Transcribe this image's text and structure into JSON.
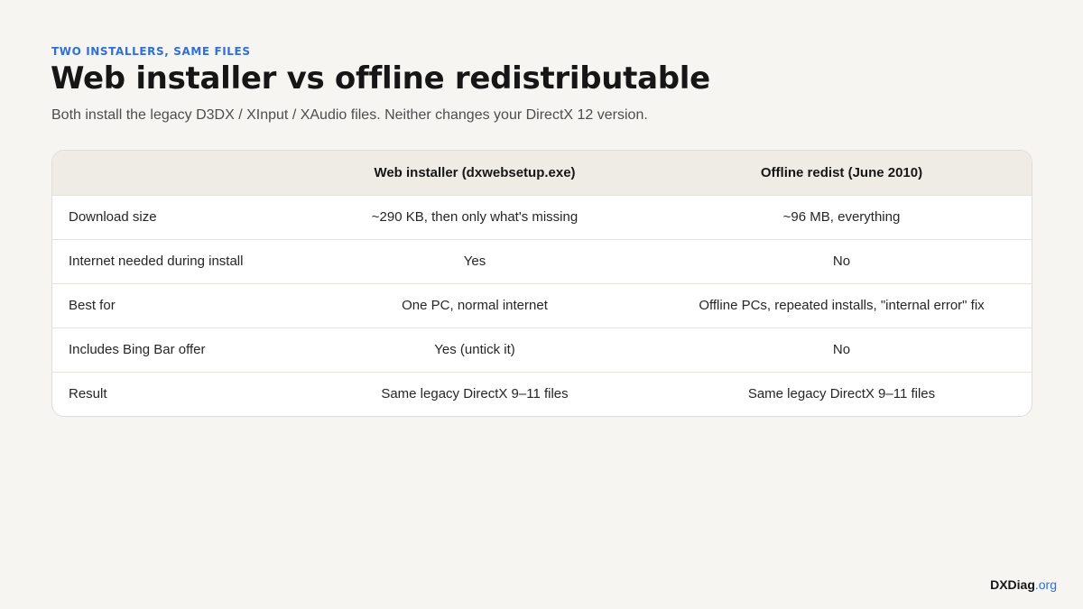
{
  "header": {
    "eyebrow": "TWO INSTALLERS, SAME FILES",
    "title": "Web installer vs offline redistributable",
    "subtitle": "Both install the legacy D3DX / XInput / XAudio files. Neither changes your DirectX 12 version."
  },
  "table": {
    "columns": [
      "",
      "Web installer (dxwebsetup.exe)",
      "Offline redist (June 2010)"
    ],
    "rows": [
      {
        "label": "Download size",
        "web": "~290 KB, then only what's missing",
        "offline": "~96 MB, everything"
      },
      {
        "label": "Internet needed during install",
        "web": "Yes",
        "offline": "No"
      },
      {
        "label": "Best for",
        "web": "One PC, normal internet",
        "offline": "Offline PCs, repeated installs, \"internal error\" fix"
      },
      {
        "label": "Includes Bing Bar offer",
        "web": "Yes (untick it)",
        "offline": "No"
      },
      {
        "label": "Result",
        "web": "Same legacy DirectX 9–11 files",
        "offline": "Same legacy DirectX 9–11 files"
      }
    ]
  },
  "footer": {
    "brand_name": "DXDiag",
    "brand_tld": ".org"
  },
  "colors": {
    "accent": "#2f6fd6",
    "background": "#f6f5f2",
    "header_row": "#efece5"
  }
}
